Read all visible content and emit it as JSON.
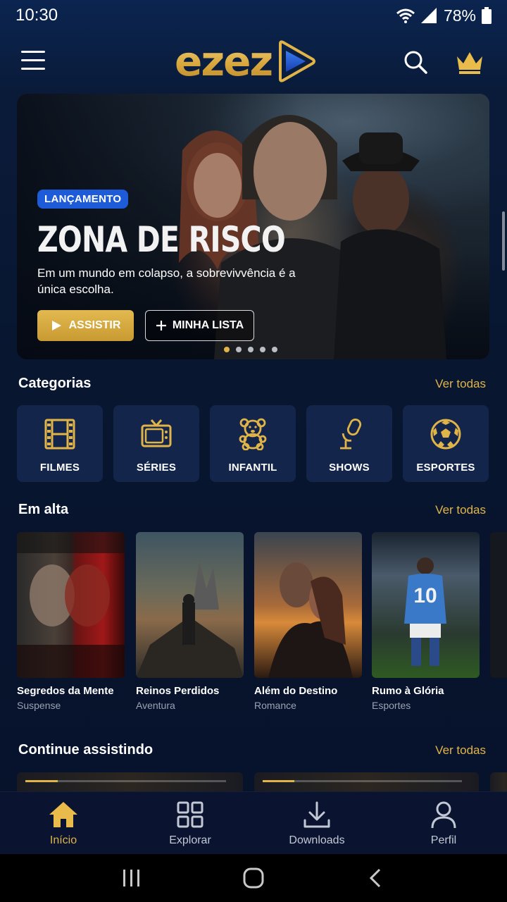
{
  "status_bar": {
    "time": "10:30",
    "battery": "78%"
  },
  "header": {
    "logo_text": "ezez"
  },
  "hero": {
    "badge": "LANÇAMENTO",
    "title": "ZONA DE RISCO",
    "description": "Em um mundo em colapso, a sobrevivvência é a única escolha.",
    "primary_button": "ASSISTIR",
    "secondary_button": "MINHA LISTA"
  },
  "categories": {
    "title": "Categorias",
    "see_all": "Ver todas",
    "items": [
      {
        "label": "FILMES",
        "icon": "film-icon"
      },
      {
        "label": "SÉRIES",
        "icon": "tv-icon"
      },
      {
        "label": "INFANTIL",
        "icon": "teddy-bear-icon"
      },
      {
        "label": "SHOWS",
        "icon": "microphone-icon"
      },
      {
        "label": "ESPORTES",
        "icon": "soccer-ball-icon"
      }
    ]
  },
  "trending": {
    "title": "Em alta",
    "see_all": "Ver todas",
    "items": [
      {
        "title": "Segredos da Mente",
        "genre": "Suspense"
      },
      {
        "title": "Reinos Perdidos",
        "genre": "Aventura"
      },
      {
        "title": "Além do Destino",
        "genre": "Romance"
      },
      {
        "title": "Rumo à Glória",
        "genre": "Esportes"
      }
    ]
  },
  "continue_watching": {
    "title": "Continue assistindo",
    "see_all": "Ver todas",
    "progress": [
      0.16,
      0.16
    ]
  },
  "bottom_nav": {
    "items": [
      {
        "label": "Início",
        "icon": "home-icon",
        "active": true
      },
      {
        "label": "Explorar",
        "icon": "grid-icon",
        "active": false
      },
      {
        "label": "Downloads",
        "icon": "download-icon",
        "active": false
      },
      {
        "label": "Perfil",
        "icon": "user-icon",
        "active": false
      }
    ]
  },
  "colors": {
    "accent": "#e0b448",
    "badge": "#1d5bd8",
    "background": "#081326",
    "card": "#13254a"
  }
}
